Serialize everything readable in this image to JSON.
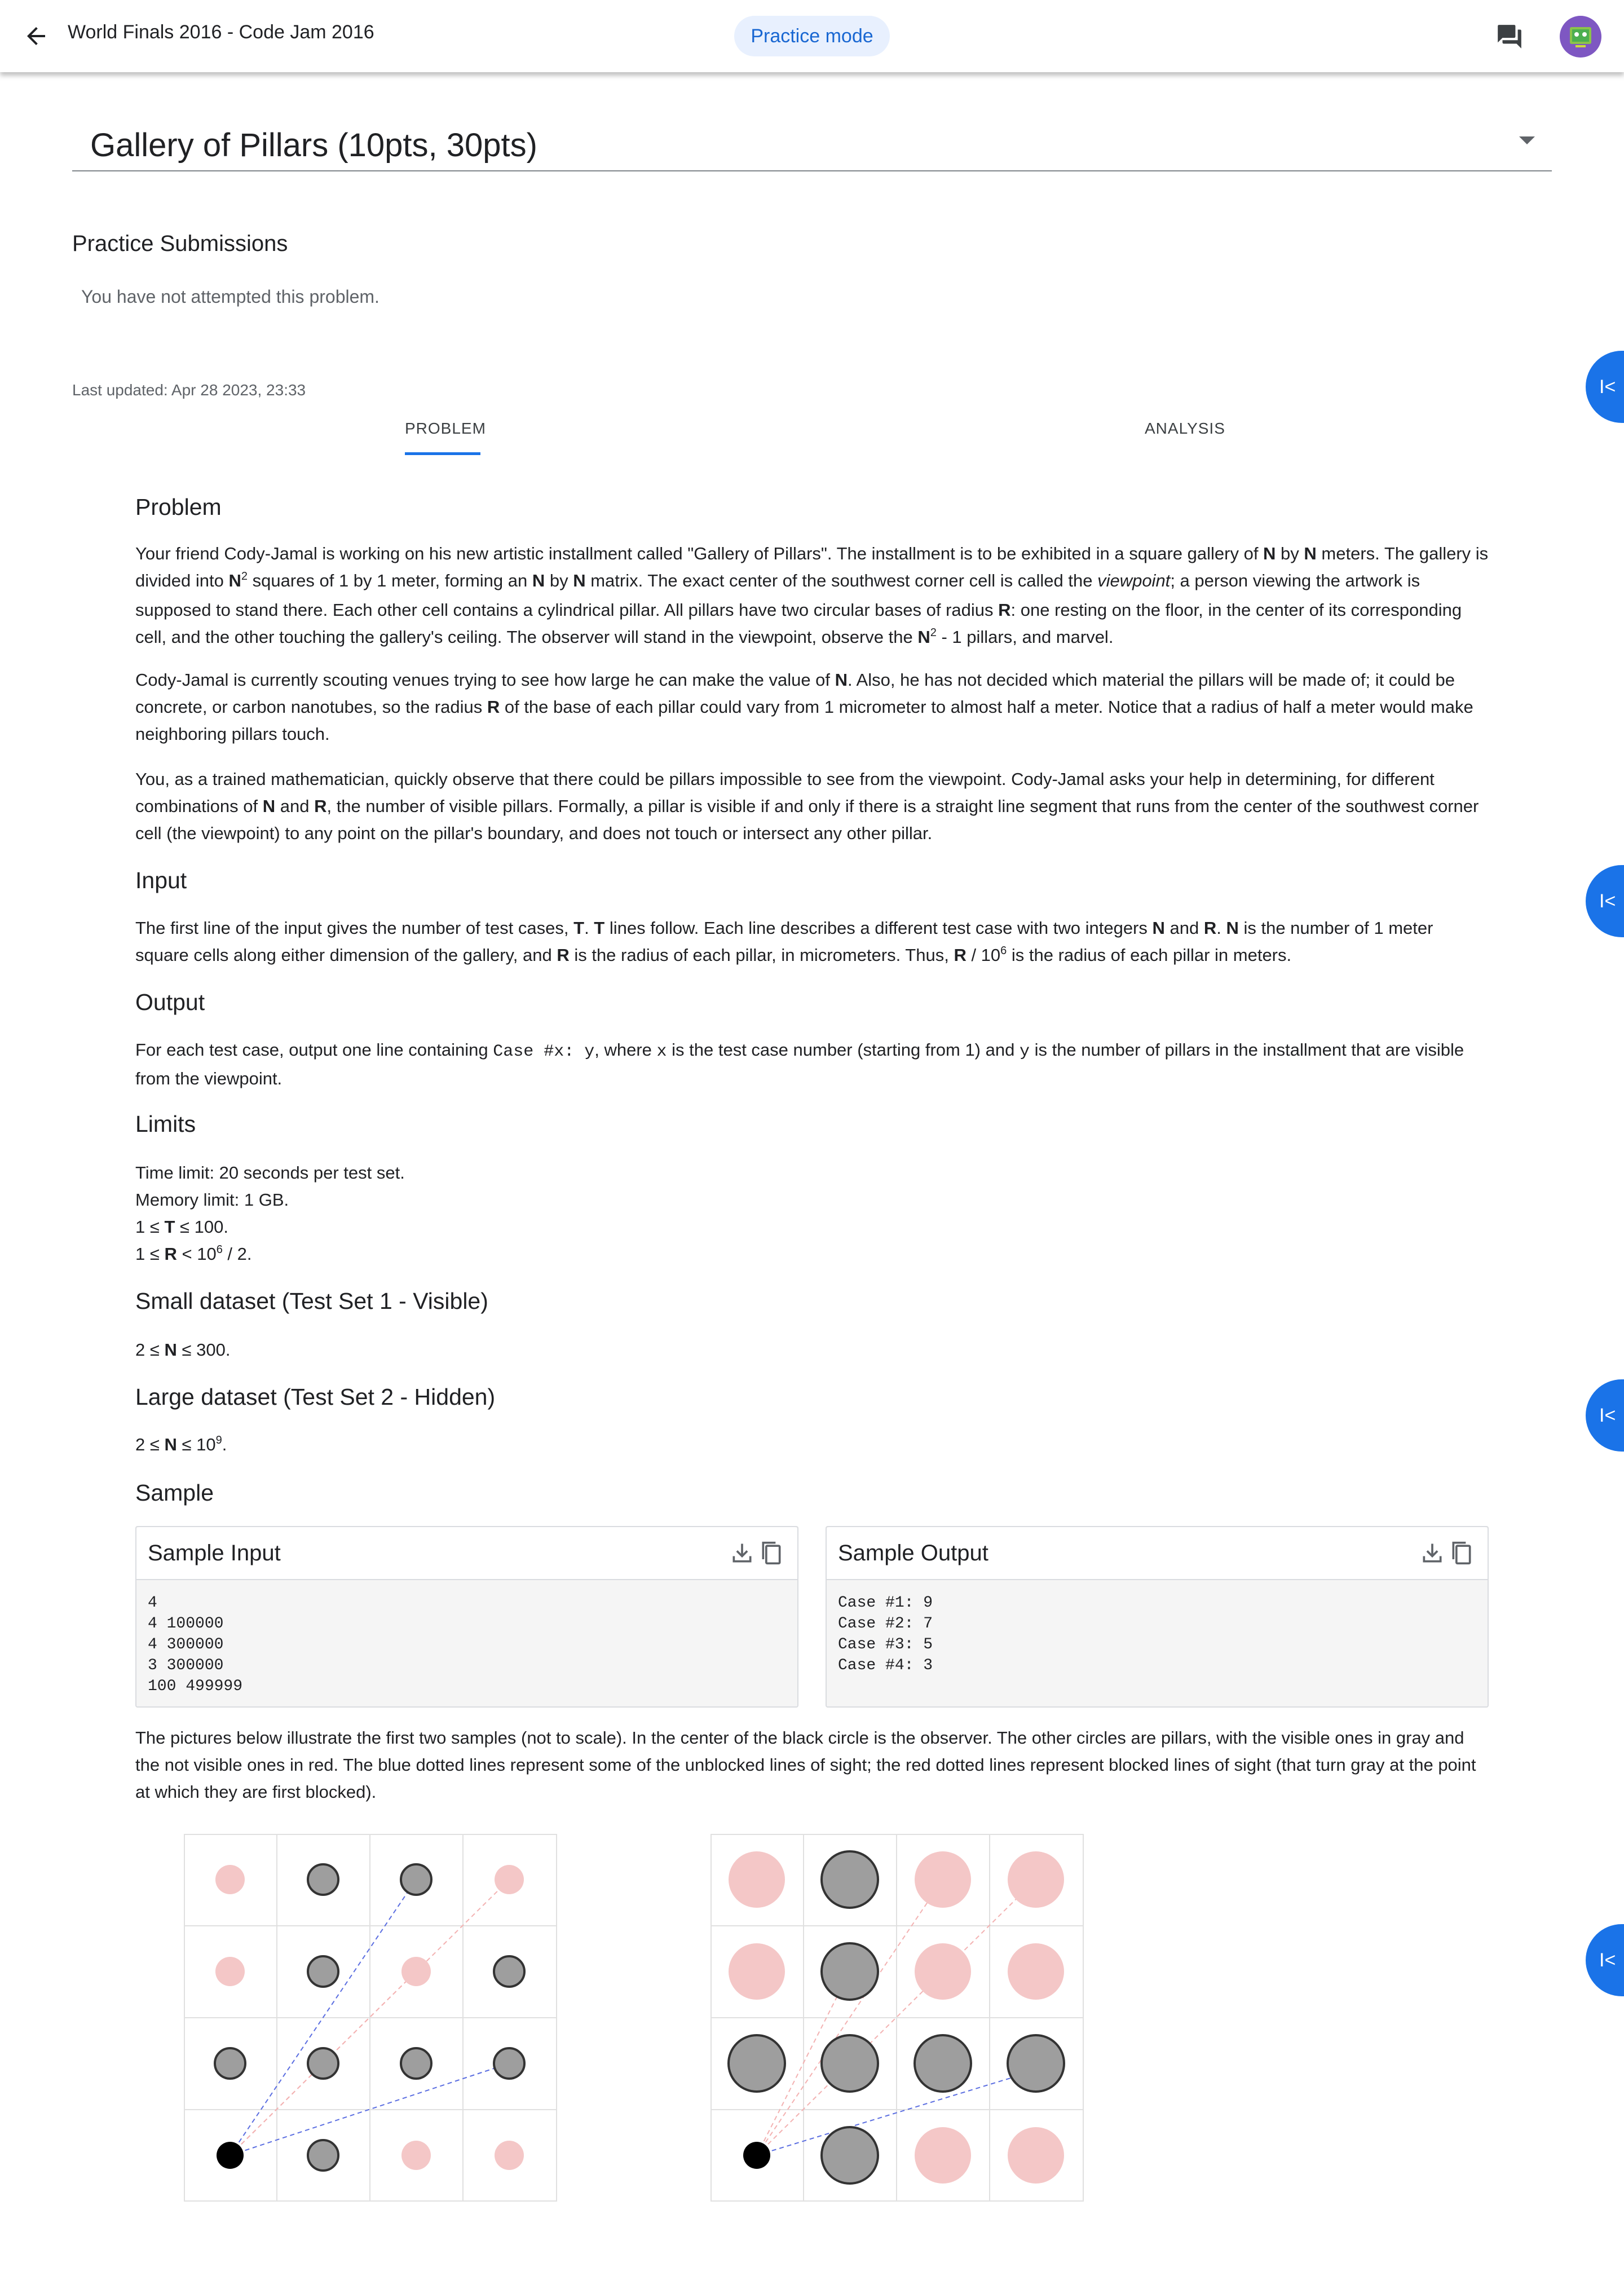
{
  "topbar": {
    "title": "World Finals 2016 - Code Jam 2016",
    "mode_chip": "Practice mode"
  },
  "problem_selector": {
    "title": "Gallery of Pillars (10pts, 30pts)"
  },
  "submissions": {
    "heading": "Practice Submissions",
    "status": "You have not attempted this problem."
  },
  "last_updated": "Last updated: Apr 28 2023, 23:33",
  "tabs": [
    "PROBLEM",
    "ANALYSIS"
  ],
  "side_button_label": "I<",
  "statement": {
    "problem_heading": "Problem",
    "p1": "Your friend Cody-Jamal is working on his new artistic installment called \"Gallery of Pillars\". The installment is to be exhibited in a square gallery of N by N meters. The gallery is divided into N2 squares of 1 by 1 meter, forming an N by N matrix. The exact center of the southwest corner cell is called the viewpoint; a person viewing the artwork is supposed to stand there. Each other cell contains a cylindrical pillar. All pillars have two circular bases of radius R: one resting on the floor, in the center of its corresponding cell, and the other touching the gallery's ceiling. The observer will stand in the viewpoint, observe the N2 - 1 pillars, and marvel.",
    "p2": "Cody-Jamal is currently scouting venues trying to see how large he can make the value of N. Also, he has not decided which material the pillars will be made of; it could be concrete, or carbon nanotubes, so the radius R of the base of each pillar could vary from 1 micrometer to almost half a meter. Notice that a radius of half a meter would make neighboring pillars touch.",
    "p3": "You, as a trained mathematician, quickly observe that there could be pillars impossible to see from the viewpoint. Cody-Jamal asks your help in determining, for different combinations of N and R, the number of visible pillars. Formally, a pillar is visible if and only if there is a straight line segment that runs from the center of the southwest corner cell (the viewpoint) to any point on the pillar's boundary, and does not touch or intersect any other pillar.",
    "input_heading": "Input",
    "input_text": "The first line of the input gives the number of test cases, T. T lines follow. Each line describes a different test case with two integers N and R. N is the number of 1 meter square cells along either dimension of the gallery, and R is the radius of each pillar, in micrometers. Thus, R / 106 is the radius of each pillar in meters.",
    "output_heading": "Output",
    "output_text": "For each test case, output one line containing Case #x: y, where x is the test case number (starting from 1) and y is the number of pillars in the installment that are visible from the viewpoint.",
    "limits_heading": "Limits",
    "limits": [
      "Time limit: 20 seconds per test set.",
      "Memory limit: 1 GB.",
      "1 ≤ T ≤ 100.",
      "1 ≤ R < 106 / 2."
    ],
    "small_heading": "Small dataset (Test Set 1 - Visible)",
    "small_limit": "2 ≤ N ≤ 300.",
    "large_heading": "Large dataset (Test Set 2 - Hidden)",
    "large_limit": "2 ≤ N ≤ 109.",
    "sample_heading": "Sample",
    "pictures_text": "The pictures below illustrate the first two samples (not to scale). In the center of the black circle is the observer. The other circles are pillars, with the visible ones in gray and the not visible ones in red. The blue dotted lines represent some of the unblocked lines of sight; the red dotted lines represent blocked lines of sight (that turn gray at the point at which they are first blocked)."
  },
  "sample_input": {
    "title": "Sample Input",
    "lines": "4\n4 100000\n4 300000\n3 300000\n100 499999"
  },
  "sample_output": {
    "title": "Sample Output",
    "lines": "Case #1: 9\nCase #2: 7\nCase #3: 5\nCase #4: 3"
  },
  "colors": {
    "accent": "#1a73e8",
    "visible_pillar": "#9e9e9e",
    "hidden_pillar": "#f4c7c7",
    "observer": "#000000"
  },
  "icons": [
    "back-arrow-icon",
    "chat-icon",
    "avatar",
    "dropdown-arrow-icon",
    "download-icon",
    "copy-icon",
    "collapse-left-icon"
  ]
}
